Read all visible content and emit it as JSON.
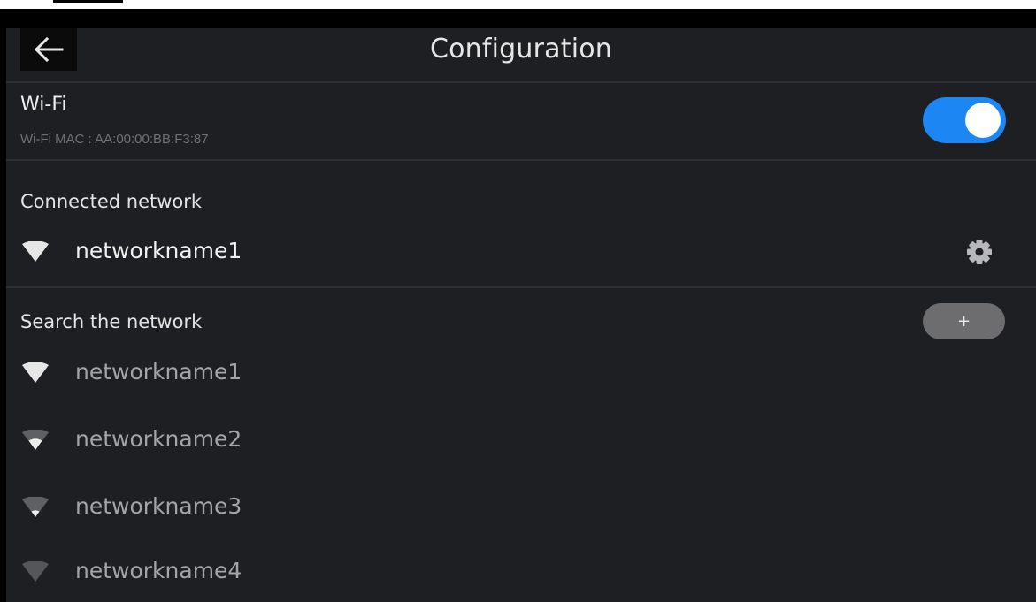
{
  "header": {
    "title": "Configuration"
  },
  "wifi": {
    "title": "Wi-Fi",
    "mac": "Wi-Fi MAC : AA:00:00:BB:F3:87",
    "enabled": true
  },
  "connected": {
    "label": "Connected network",
    "network": "networkname1"
  },
  "search": {
    "label": "Search the network",
    "add_label": "+",
    "networks": [
      {
        "name": "networkname1",
        "signal": 4
      },
      {
        "name": "networkname2",
        "signal": 3
      },
      {
        "name": "networkname3",
        "signal": 2
      },
      {
        "name": "networkname4",
        "signal": 1
      }
    ]
  },
  "colors": {
    "background": "#1e1f22",
    "accent": "#1c86f2",
    "text_primary": "#f0f0f0",
    "text_secondary": "#a5a5a7"
  }
}
